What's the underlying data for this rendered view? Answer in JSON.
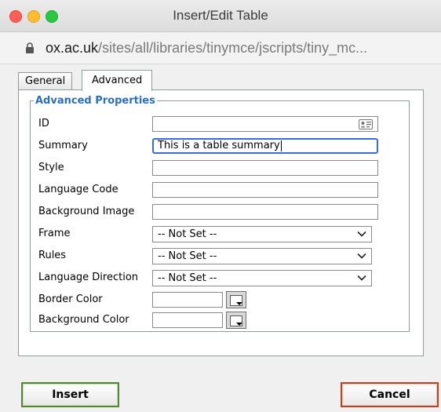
{
  "window": {
    "title": "Insert/Edit Table"
  },
  "urlbar": {
    "domain": "ox.ac.uk",
    "path": "/sites/all/libraries/tinymce/jscripts/tiny_mc..."
  },
  "tabs": [
    {
      "label": "General"
    },
    {
      "label": "Advanced"
    }
  ],
  "advanced": {
    "legend": "Advanced Properties",
    "fields": {
      "id": {
        "label": "ID",
        "value": ""
      },
      "summary": {
        "label": "Summary",
        "value": "This is a table summary"
      },
      "style": {
        "label": "Style",
        "value": ""
      },
      "language_code": {
        "label": "Language Code",
        "value": ""
      },
      "background_image": {
        "label": "Background Image",
        "value": ""
      },
      "frame": {
        "label": "Frame",
        "selected": "-- Not Set --"
      },
      "rules": {
        "label": "Rules",
        "selected": "-- Not Set --"
      },
      "language_direction": {
        "label": "Language Direction",
        "selected": "-- Not Set --"
      },
      "border_color": {
        "label": "Border Color",
        "value": ""
      },
      "background_color": {
        "label": "Background Color",
        "value": ""
      }
    }
  },
  "buttons": {
    "insert": "Insert",
    "cancel": "Cancel"
  },
  "colors": {
    "legend": "#2b6fb6",
    "insert_border": "#4f8a2f",
    "cancel_border": "#b2452b",
    "focus": "#3a6ad8"
  }
}
